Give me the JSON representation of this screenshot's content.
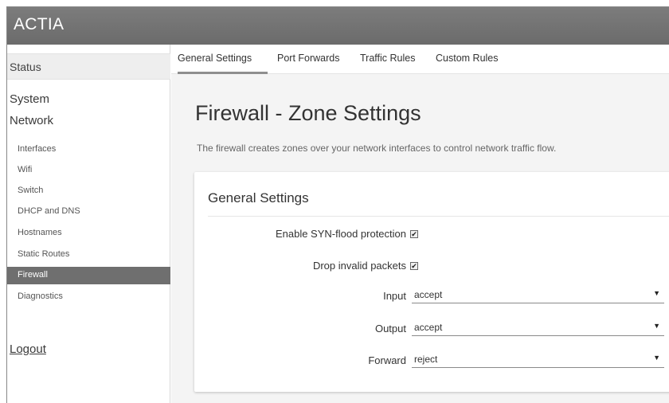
{
  "header": {
    "brand": "ACTIA"
  },
  "sidebar": {
    "status": "Status",
    "system": "System",
    "network": "Network",
    "items": [
      {
        "label": "Interfaces"
      },
      {
        "label": "Wifi"
      },
      {
        "label": "Switch"
      },
      {
        "label": "DHCP and DNS"
      },
      {
        "label": "Hostnames"
      },
      {
        "label": "Static Routes"
      },
      {
        "label": "Firewall",
        "active": true
      },
      {
        "label": "Diagnostics"
      }
    ],
    "logout": "Logout"
  },
  "tabs": [
    {
      "label": "General Settings",
      "active": true
    },
    {
      "label": "Port Forwards"
    },
    {
      "label": "Traffic Rules"
    },
    {
      "label": "Custom Rules"
    }
  ],
  "page": {
    "title": "Firewall - Zone Settings",
    "description": "The firewall creates zones over your network interfaces to control network traffic flow."
  },
  "general_settings": {
    "title": "General Settings",
    "syn_flood_label": "Enable SYN-flood protection",
    "syn_flood_checked": true,
    "drop_invalid_label": "Drop invalid packets",
    "drop_invalid_checked": true,
    "input_label": "Input",
    "input_value": "accept",
    "output_label": "Output",
    "output_value": "accept",
    "forward_label": "Forward",
    "forward_value": "reject"
  },
  "icons": {
    "checkbox_checked": "✔",
    "caret": "▼"
  },
  "colors": {
    "header_bg": "#737373",
    "active_item_bg": "#6f6f6f",
    "main_bg": "#f4f4f4"
  }
}
